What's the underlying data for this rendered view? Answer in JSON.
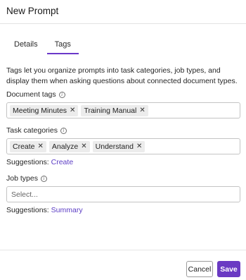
{
  "dialog": {
    "title": "New Prompt"
  },
  "tabs": [
    {
      "label": "Details",
      "active": false
    },
    {
      "label": "Tags",
      "active": true
    }
  ],
  "description": "Tags let you organize prompts into task categories, job types, and display them when asking questions about connected document types.",
  "document_tags": {
    "label": "Document tags",
    "chips": [
      "Meeting Minutes",
      "Training Manual"
    ]
  },
  "task_categories": {
    "label": "Task categories",
    "chips": [
      "Create",
      "Analyze",
      "Understand"
    ],
    "suggestions_label": "Suggestions:",
    "suggestions": [
      "Create"
    ]
  },
  "job_types": {
    "label": "Job types",
    "placeholder": "Select...",
    "suggestions_label": "Suggestions:",
    "suggestions": [
      "Summary"
    ]
  },
  "footer": {
    "cancel_label": "Cancel",
    "save_label": "Save"
  },
  "colors": {
    "accent": "#6a3ac3",
    "link": "#5b3cc4",
    "chip_bg": "#ececec"
  },
  "icons": {
    "info": "info-circle-icon",
    "remove": "close-x-icon"
  }
}
